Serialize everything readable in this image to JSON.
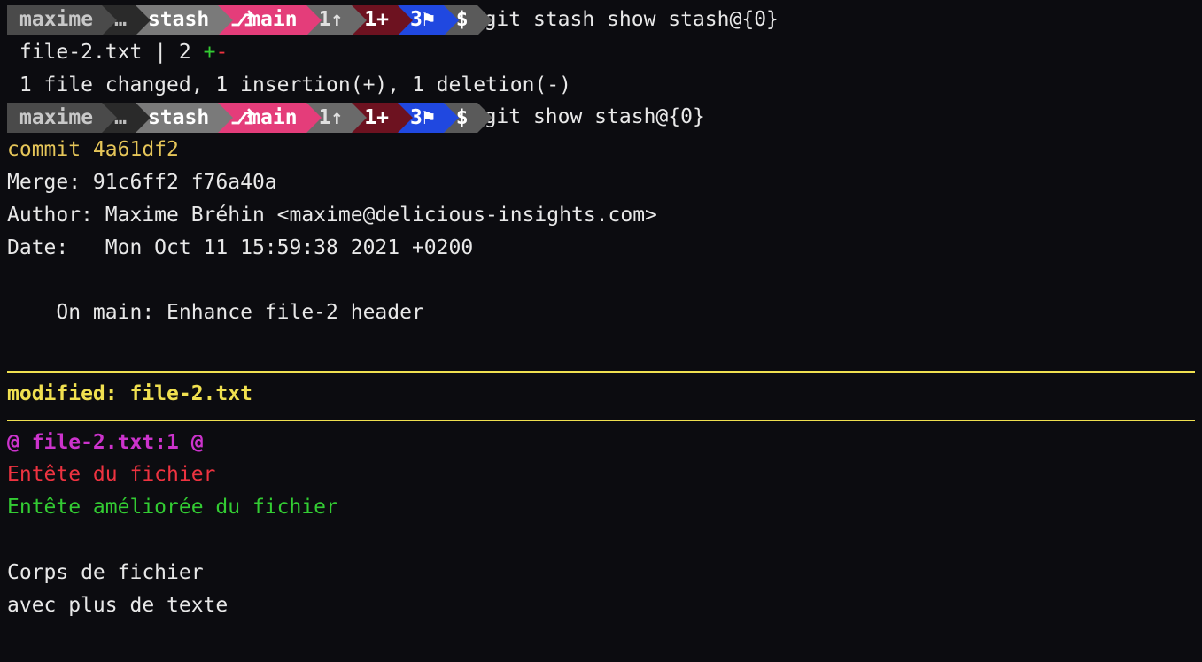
{
  "prompt": {
    "user": "maxime",
    "dots": "…",
    "dir": "stash",
    "branch_icon": "⎇",
    "branch": "main",
    "ahead": "1↑",
    "plus": "1+",
    "flag": "3⚑",
    "dollar": "$"
  },
  "cmd1": "git stash show stash@{0}",
  "diffstat": {
    "file": "file-2.txt",
    "bar": "|",
    "count": "2",
    "plus": "+",
    "minus": "-",
    "summary": " 1 file changed, 1 insertion(+), 1 deletion(-)"
  },
  "cmd2": "git show stash@{0}",
  "commit": {
    "line": "commit 4a61df2",
    "merge": "Merge: 91c6ff2 f76a40a",
    "author": "Author: Maxime Bréhin <maxime@delicious-insights.com>",
    "date": "Date:   Mon Oct 11 15:59:38 2021 +0200",
    "msg": "    On main: Enhance file-2 header"
  },
  "modified": "modified: file-2.txt",
  "hunk": "@ file-2.txt:1 @",
  "del_line": "Entête du fichier",
  "add_line": "Entête améliorée du fichier",
  "ctx1": "Corps de fichier",
  "ctx2": "avec plus de texte"
}
